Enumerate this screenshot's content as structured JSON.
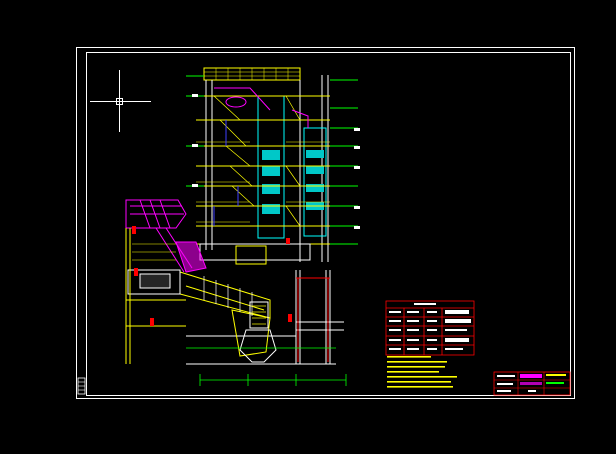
{
  "colors": {
    "background": "#000000",
    "frame": "#ffffff",
    "structure_yellow": "#ffff00",
    "structure_white": "#ffffff",
    "hot_section_magenta": "#ff00ff",
    "panel_cyan": "#00ffff",
    "dimension_green": "#00ff00",
    "table_red": "#ff0000",
    "accent_blue": "#4040ff"
  },
  "icons": {
    "crosshair": "crosshair-cursor-icon"
  },
  "drawing": {
    "description_visible": false
  }
}
